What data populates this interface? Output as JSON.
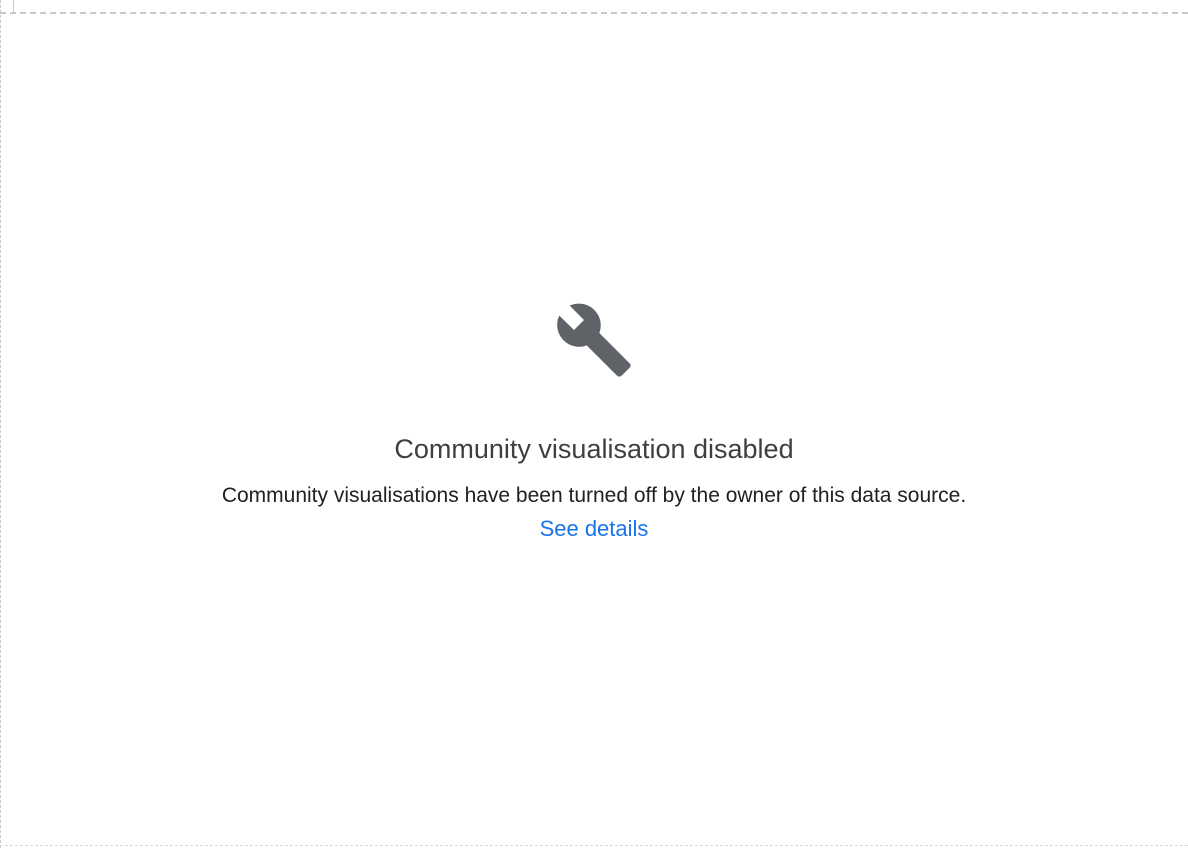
{
  "panel": {
    "icon": "wrench-icon",
    "title": "Community visualisation disabled",
    "message": "Community visualisations have been turned off by the owner of this data source.",
    "link_label": "See details"
  },
  "colors": {
    "icon": "#5f6368",
    "title": "#3c4043",
    "message": "#202124",
    "link": "#1a73e8",
    "border_dash": "#c8c8cc"
  }
}
